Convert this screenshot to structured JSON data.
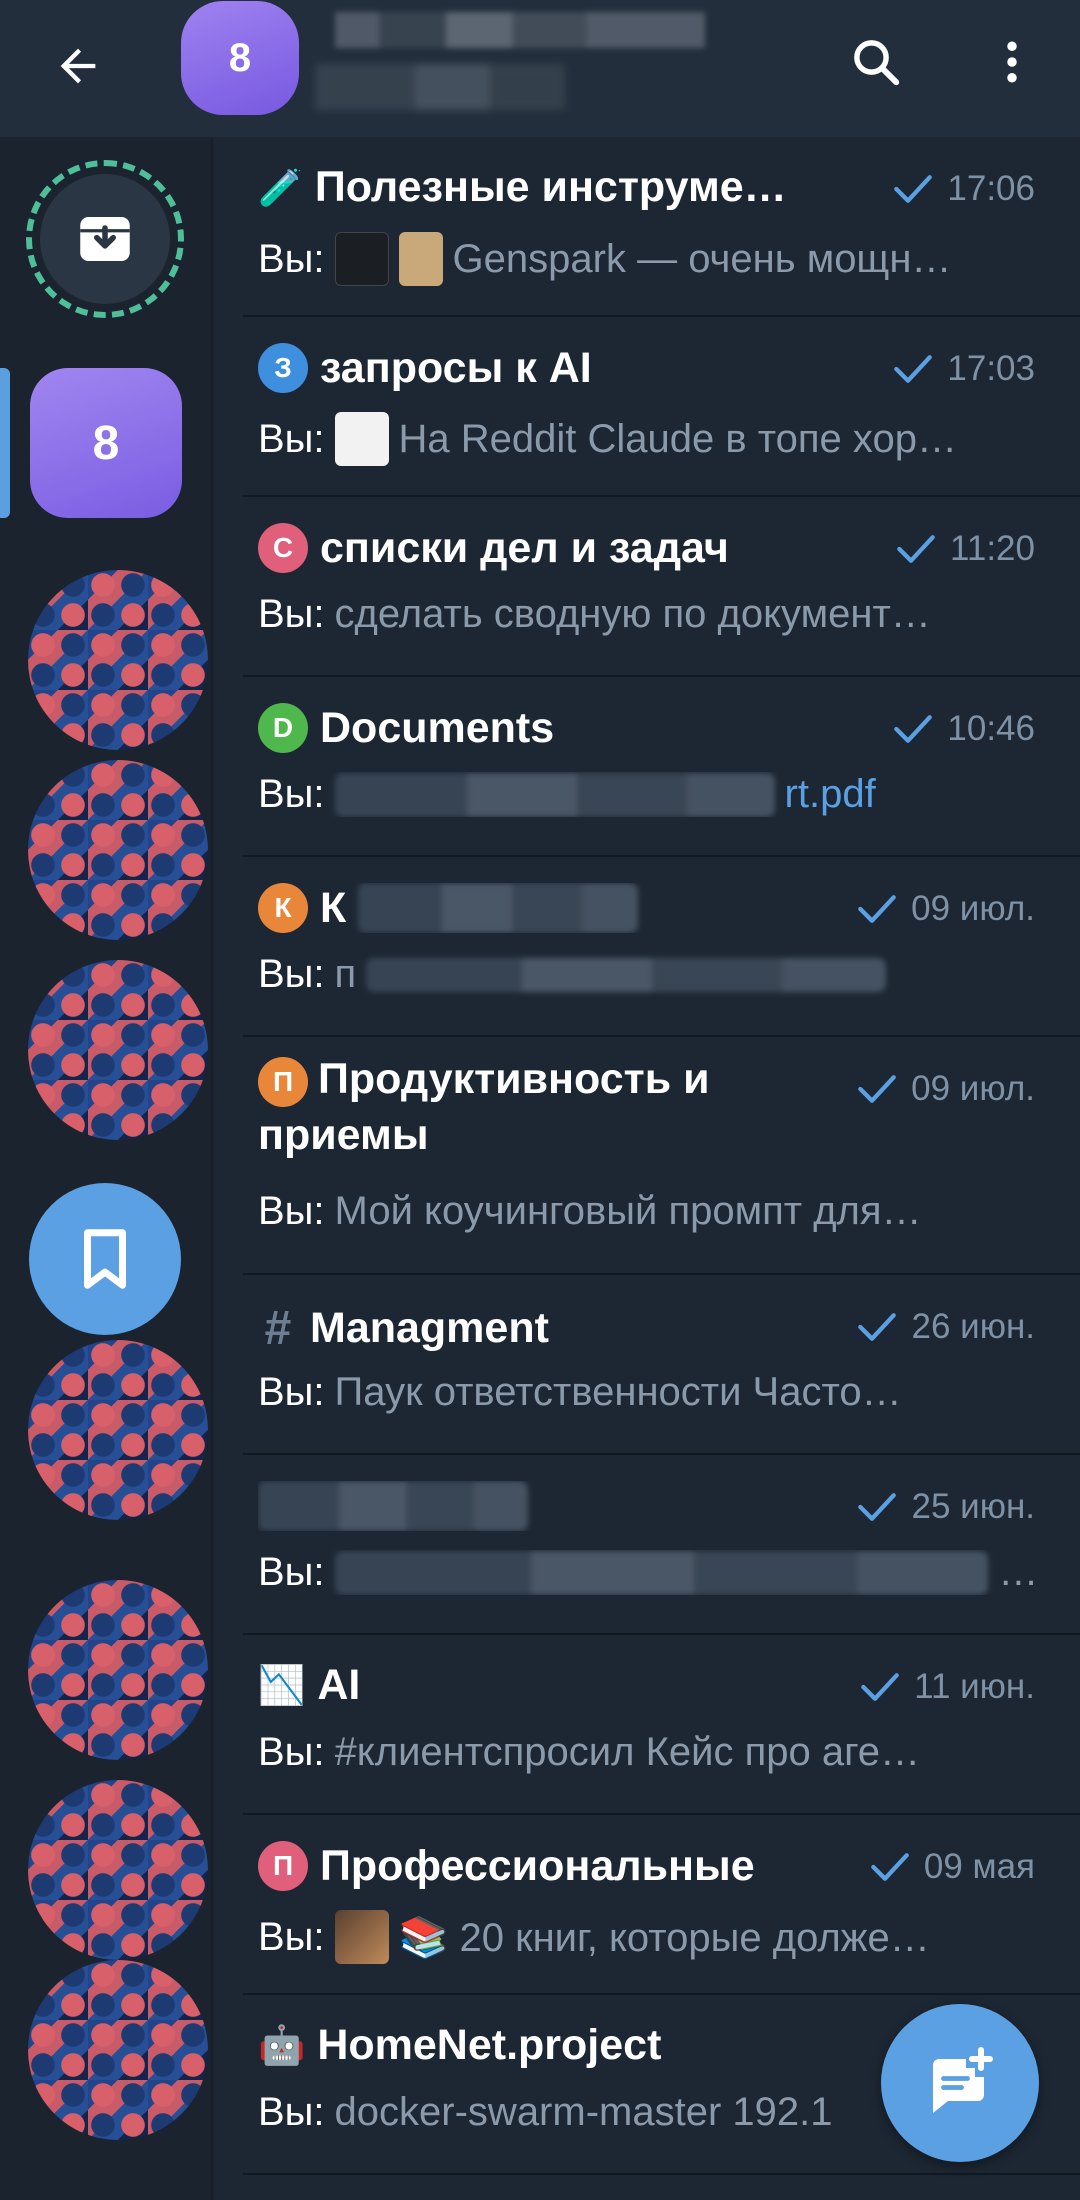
{
  "header": {
    "avatar_label": "8",
    "back_icon": "arrow-left-icon",
    "search_icon": "search-icon",
    "menu_icon": "more-vertical-icon"
  },
  "sidebar": {
    "archive_icon": "archive-icon",
    "active_folder_label": "8",
    "saved_icon": "bookmark-icon"
  },
  "chats": [
    {
      "title": "Полезные инструме…",
      "icon": "🧪",
      "time": "17:06",
      "you": "Вы:",
      "preview": "Genspark — очень мощн…",
      "has_thumb": true
    },
    {
      "title": "запросы к AI",
      "icon_letter": "З",
      "icon_color": "#3f8fdf",
      "time": "17:03",
      "you": "Вы:",
      "preview": "На Reddit Claude в топе хор…",
      "has_thumb": true
    },
    {
      "title": "списки дел и задач",
      "icon_letter": "С",
      "icon_color": "#e05f7a",
      "time": "11:20",
      "you": "Вы:",
      "preview": "сделать сводную по документ…"
    },
    {
      "title": "Documents",
      "icon_letter": "D",
      "icon_color": "#4fb84c",
      "time": "10:46",
      "you": "Вы:",
      "preview": "rt.pdf"
    },
    {
      "title": "К",
      "icon_letter": "К",
      "icon_color": "#e8873a",
      "time": "09 июл.",
      "you": "Вы:",
      "preview": "п"
    },
    {
      "title": "Продуктивность и приемы",
      "icon_letter": "П",
      "icon_color": "#e8873a",
      "time": "09 июл.",
      "you": "Вы:",
      "preview": "Мой коучинговый промпт для…"
    },
    {
      "title": "Managment",
      "icon": "#",
      "time": "26 июн.",
      "you": "Вы:",
      "preview": "Паук ответственности  Часто…"
    },
    {
      "title": "",
      "time": "25 июн.",
      "you": "Вы:",
      "preview": "…"
    },
    {
      "title": "AI",
      "icon": "📉",
      "time": "11 июн.",
      "you": "Вы:",
      "preview": "#клиентспросил Кейс про аге…"
    },
    {
      "title": "Профессиональные",
      "icon_letter": "П",
      "icon_color": "#e05f7a",
      "time": "09 мая",
      "you": "Вы:",
      "preview": "📚 20 книг, которые долже…",
      "has_thumb": true
    },
    {
      "title": "HomeNet.project",
      "icon": "🤖",
      "time": "",
      "you": "Вы:",
      "preview": "docker-swarm-master 192.1"
    }
  ],
  "fab": {
    "icon": "new-message-icon"
  },
  "colors": {
    "accent": "#5aa0e3",
    "background": "#1d2733",
    "header": "#232e3c",
    "folder_purple": "#8b6fe8"
  }
}
